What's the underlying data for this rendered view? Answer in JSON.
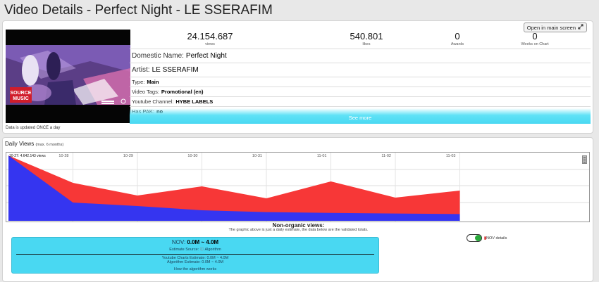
{
  "page": {
    "title": "Video Details - Perfect Night - LE SSERAFIM"
  },
  "stats": [
    {
      "value": "24.154.687",
      "label": "views"
    },
    {
      "value": "540.801",
      "label": "likes"
    },
    {
      "value": "0",
      "label": "Awards"
    },
    {
      "value": "0",
      "label": "Weeks on Chart"
    }
  ],
  "open_button": {
    "label": "Open in main screen",
    "icon": "expand-icon"
  },
  "thumbnail": {
    "logo_line1": "SOURCE",
    "logo_line2": "MUSIC",
    "icon": "video-thumbnail"
  },
  "update_note": "Data is updated ONCE a day",
  "info": {
    "domestic_name": {
      "key": "Domestic Name:",
      "value": "Perfect Night"
    },
    "artist": {
      "key": "Artist:",
      "value": "LE SSERAFIM"
    },
    "type": {
      "key": "Type:",
      "value": "Main"
    },
    "tags": {
      "key": "Video Tags:",
      "value": "Promotional (en)"
    },
    "channel": {
      "key": "Youtube Channel:",
      "value": "HYBE LABELS"
    },
    "pak": {
      "key": "Has PAK:",
      "value": "no"
    }
  },
  "see_more": "See more",
  "daily_views": {
    "title": "Daily Views",
    "subtitle": "(max. 6 months)"
  },
  "chart_data": {
    "type": "area",
    "categories": [
      "10-27",
      "10-28",
      "10-29",
      "10-30",
      "10-31",
      "11-01",
      "11-02",
      "11-03"
    ],
    "x_labels": [
      "10-28",
      "10-29",
      "10-30",
      "10-31",
      "11-01",
      "11-02",
      "11-03"
    ],
    "series": [
      {
        "values": [
          4642143,
          1300000,
          1050000,
          750000,
          620000,
          560000,
          520000,
          480000
        ]
      },
      {
        "values": [
          4642143,
          2700000,
          1800000,
          2450000,
          1600000,
          2800000,
          1650000,
          2150000
        ]
      }
    ],
    "ylim": [
      0,
      4700000
    ],
    "colors": [
      "#3535f0",
      "#f73737"
    ],
    "annotation": "10-27: 4.642.143 views",
    "grid": true
  },
  "nov": {
    "title": "Non-organic views:",
    "note": "The graphic above is just a daily estimate, the data below are the validated totals.",
    "label": "NOV:",
    "value": "0.0M ~ 4.0M",
    "source_label": "Estimate Source:",
    "source_value": "Algorithm",
    "yt_estimate": "Youtube Charts Estimate: 0.0M ~ 4.0M",
    "algo_estimate": "Algorithm Estimate: 0.0M ~ 4.0M",
    "how": "How the algorithm works",
    "toggle_label": "NOV details",
    "toggle_on": true
  }
}
